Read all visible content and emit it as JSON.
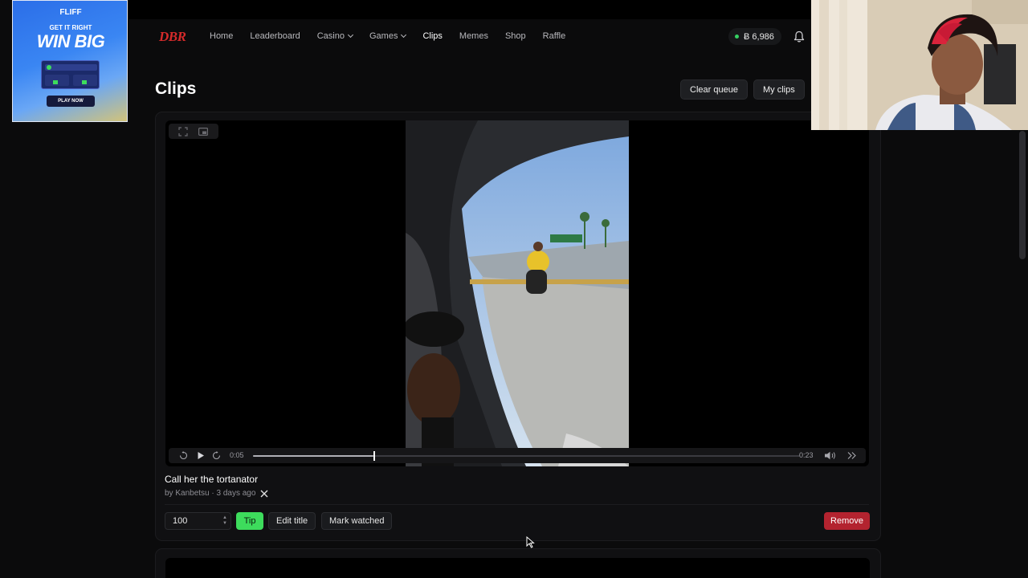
{
  "nav": {
    "logo": "DBR",
    "links": [
      "Home",
      "Leaderboard",
      "Casino",
      "Games",
      "Clips",
      "Memes",
      "Shop",
      "Raffle"
    ],
    "balance": "Ƀ 6,986"
  },
  "header": {
    "title": "Clips",
    "clear_queue": "Clear queue",
    "my_clips": "My clips"
  },
  "player": {
    "current_time": "0:05",
    "duration": "0:23",
    "progress": 0.22
  },
  "clip": {
    "title": "Call her the tortanator",
    "meta": "by Kanbetsu · 3 days ago"
  },
  "actions": {
    "tip_amount": "100",
    "tip": "Tip",
    "edit_title": "Edit title",
    "mark_watched": "Mark watched",
    "remove": "Remove"
  },
  "ad": {
    "brand": "FLIFF",
    "line1": "GET IT RIGHT",
    "line2": "WIN BIG",
    "cta": "PLAY NOW"
  },
  "colors": {
    "accent_green": "#3ddc5c",
    "danger_red": "#b3232f",
    "logo_red": "#d42a2a"
  }
}
